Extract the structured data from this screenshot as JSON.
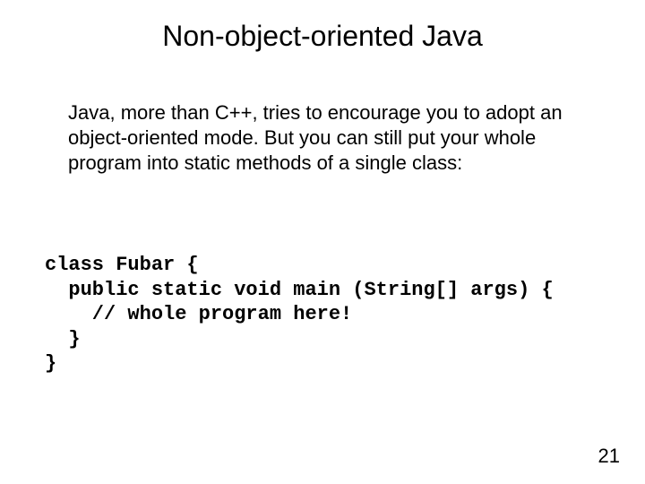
{
  "title": "Non-object-oriented Java",
  "body": "Java, more than C++, tries to encourage you to adopt an object-oriented mode.  But you can still put your whole program into static methods of a single class:",
  "code": "class Fubar {\n  public static void main (String[] args) {\n    // whole program here!\n  }\n}",
  "page_number": "21"
}
